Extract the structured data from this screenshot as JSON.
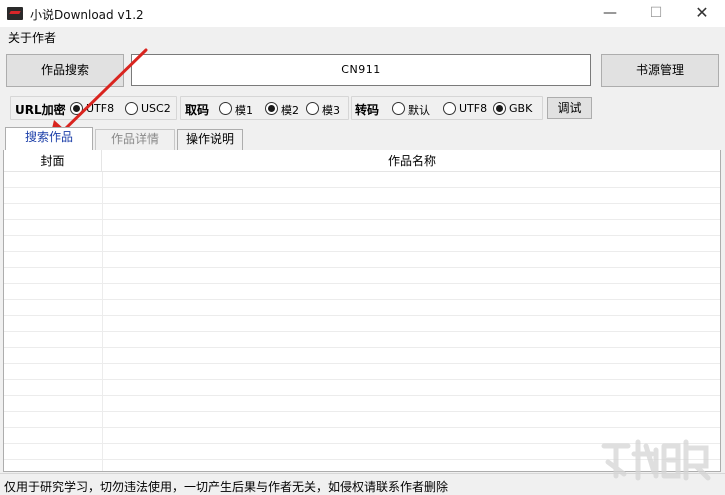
{
  "window": {
    "title": "小说Download v1.2",
    "minimize": "—",
    "maximize": "☐",
    "close": "✕"
  },
  "menu": {
    "about": "关于作者"
  },
  "toolbar": {
    "search_button": "作品搜索",
    "search_value": "CN911",
    "source_button": "书源管理"
  },
  "options": {
    "url_encode": {
      "label": "URL加密",
      "options": [
        "UTF8",
        "USC2"
      ],
      "selected": "UTF8"
    },
    "fetch": {
      "label": "取码",
      "options": [
        "模1",
        "模2",
        "模3"
      ],
      "selected": "模2"
    },
    "transcode": {
      "label": "转码",
      "options": [
        "默认",
        "UTF8",
        "GBK"
      ],
      "selected": "GBK"
    },
    "debug_button": "调试"
  },
  "tabs": [
    {
      "label": "搜索作品",
      "active": true
    },
    {
      "label": "作品详情",
      "active": false
    },
    {
      "label": "操作说明",
      "active": false
    }
  ],
  "table": {
    "columns": [
      "封面",
      "作品名称"
    ],
    "rows": []
  },
  "status": {
    "text": "仅用于研究学习，切勿违法使用，一切产生后果与作者无关，如侵权请联系作者删除"
  },
  "colors": {
    "annotation_arrow": "#d9241f",
    "active_tab_text": "#1b3ea8"
  },
  "icons": {
    "app": "app-logo-icon",
    "annotation": "red-arrow-annotation"
  }
}
